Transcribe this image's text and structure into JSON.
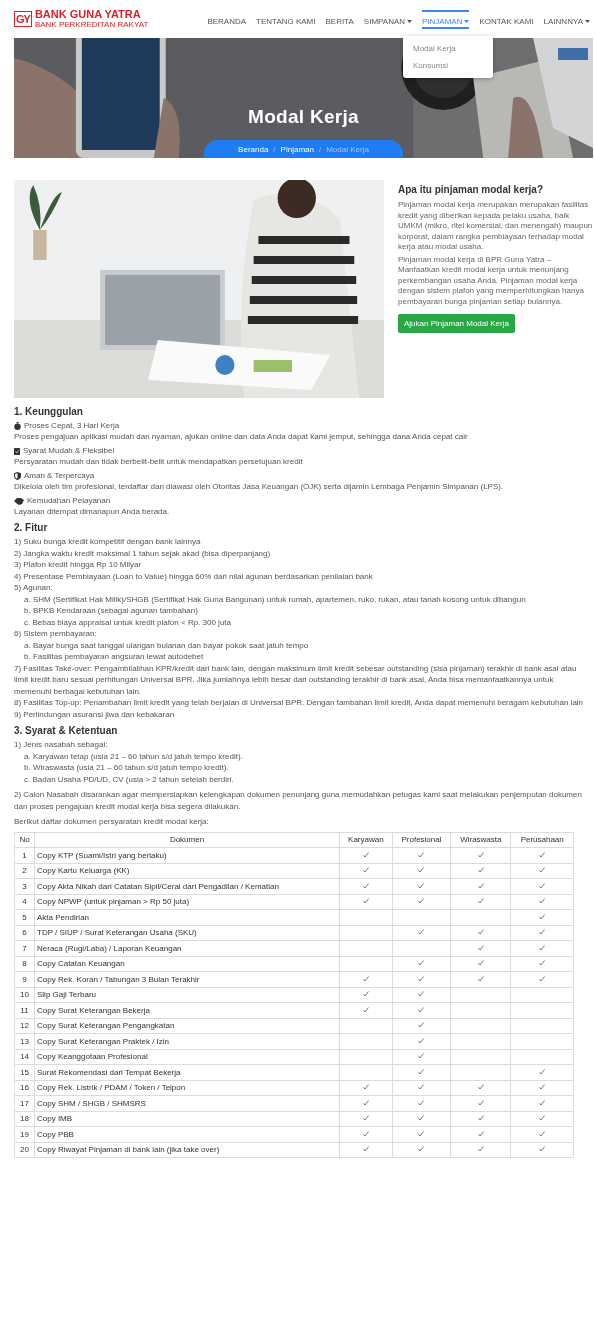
{
  "header": {
    "logo_mark": "GY",
    "brand": "BANK GUNA YATRA",
    "tagline": "BANK PERKREDITAN RAKYAT",
    "nav": [
      {
        "label": "BERANDA",
        "selected": false,
        "dropdown": false
      },
      {
        "label": "TENTANG KAMI",
        "selected": false,
        "dropdown": false
      },
      {
        "label": "BERITA",
        "selected": false,
        "dropdown": false
      },
      {
        "label": "SIMPANAN",
        "selected": false,
        "dropdown": true
      },
      {
        "label": "PINJAMAN",
        "selected": true,
        "dropdown": true,
        "menu": [
          "Modal Kerja",
          "Konsumsi"
        ]
      },
      {
        "label": "KONTAK KAMI",
        "selected": false,
        "dropdown": false
      },
      {
        "label": "LAINNNYA",
        "selected": false,
        "dropdown": true
      }
    ]
  },
  "hero": {
    "title": "Modal Kerja",
    "breadcrumb": [
      {
        "label": "Beranda",
        "current": false
      },
      {
        "label": "Pinjaman",
        "current": false
      },
      {
        "label": "Modal Kerja",
        "current": true
      }
    ],
    "separator": "/"
  },
  "intro": {
    "heading": "Apa itu pinjaman modal kerja?",
    "paragraphs": [
      "Pinjaman modal kerja merupakan merupakan fasilitas kredit yang diberikan kepada pelaku usaha, baik UMKM (mikro, ritel komersial, dan menengah) maupun korporat, dalam rangka pembiayaan terhadap modal kerja atau modal usaha.",
      "Pinjaman modal kerja di BPR Guna Yatra – Manfaatkan kredit modal kerja untuk menunjang perkembangan usaha Anda. Pinjaman modal kerja dengan sistem plafon yang memperhitungkan hanya pembayaran bunga pinjaman setiap bulannya."
    ],
    "button": "Ajukan Pinjaman Modal Kerja"
  },
  "advantages": {
    "heading": "1. Keunggulan",
    "items": [
      {
        "title": "Proses Cepat, 3 Hari Kerja",
        "text": "Proses pengajuan aplikasi mudah dan nyaman, ajukan online dan data Anda dapat kami jemput, sehingga dana Anda cepat cair"
      },
      {
        "title": "Syarat Mudah & Fleksibel",
        "text": "Persyaratan mudah dan tidak berbelit-belit untuk mendapatkan persetujuan kredit"
      },
      {
        "title": "Aman & Terpercaya",
        "text": "Dikelola oleh tim profesional, terdaftar dan diawasi oleh Otoritas Jasa Keuangan (OJK) serta dijamin Lembaga Penjamin Simpanan (LPS)."
      },
      {
        "title": "Kemudahan Pelayanan",
        "text": "Layanan ditempat dimanapun Anda berada."
      }
    ]
  },
  "features": {
    "heading": "2. Fitur",
    "items": [
      {
        "text": "1) Suku bunga kredit kompetitif dengan bank lainnya"
      },
      {
        "text": "2) Jangka waktu kredit maksimal 1 tahun sejak akad (bisa diperpanjang)"
      },
      {
        "text": "3) Plafon kredit hingga Rp 10 Milyar"
      },
      {
        "text": "4) Presentase Pembiayaan (Loan to Value) hingga 60% dari nilai agunan berdasarkan penilaian bank"
      },
      {
        "text": "5) Agunan:",
        "children": [
          "a. SHM (Sertifikat Hak Milik)/SHGB (Sertifikat Hak Guna Bangunan) untuk rumah, apartemen, ruko, rukan, atau tanah kosong untuk dibangun",
          "b. BPKB Kendaraan (sebagai agunan tambahan)",
          "c. Bebas biaya appraisal untuk kredit plafon < Rp. 300 juta"
        ]
      },
      {
        "text": "6) Sistem pembayaran:",
        "children": [
          "a. Bayar bunga saat tanggal ulangan bulanan dan bayar pokok saat jatuh tempo",
          "b. Fasilitas pembayaran angsuran lewat autodebet"
        ]
      },
      {
        "text": "7) Fasilitas Take-over: Pengambilalihan KPR/kredit dari bank lain, dengan maksimum limit kredit sebesar outstanding (sisa pinjaman) terakhir di bank asal atau limit kredit baru sesuai perhitungan Universal BPR. Jika jumlahnya lebih besar dari outstanding terakhir di bank asal, Anda bisa memanfaatkannya untuk memenuhi berbagai kebutuhan lain."
      },
      {
        "text": "8) Fasilitas Top-up: Penambahan limit kredit yang telah berjalan di Universal BPR. Dengan tambahan limit kredit, Anda dapat memenuhi beragam kebutuhan lain"
      },
      {
        "text": "9) Perlindungan asuransi jiwa dan kebakaran"
      }
    ]
  },
  "terms": {
    "heading": "3. Syarat & Ketentuan",
    "items": [
      {
        "text": "1) Jenis nasabah sebagai:",
        "children": [
          "a. Karyawan tetap (usia 21 – 60 tahun s/d jatuh tempo kredit).",
          "b. Wiraswasta (usia 21 – 60 tahun s/d jatuh tempo kredit).",
          "c. Badan Usaha PD/UD, CV (usia > 2 tahun setelah berdiri."
        ]
      },
      {
        "text": "2) Calon Nasabah disarankan agar mempersiapkan kelengkapan dokumen penunjang guna memudahkan petugas kami saat melakukan penjemputan dokumen dan proses pengajuan kredit modal kerja bisa segera dilakukan."
      },
      {
        "text": "Berikut daftar dokumen persyaratan kredit modal kerja:"
      }
    ],
    "table": {
      "columns": [
        "No",
        "Dokumen",
        "Karyawan",
        "Profesional",
        "Wiraswasta",
        "Perusahaan"
      ],
      "rows": [
        {
          "no": "1",
          "document": "Copy KTP (Suami/Istri yang berlaku)",
          "checks": [
            true,
            true,
            true,
            true
          ]
        },
        {
          "no": "2",
          "document": "Copy Kartu Keluarga (KK)",
          "checks": [
            true,
            true,
            true,
            true
          ]
        },
        {
          "no": "3",
          "document": "Copy Akta Nikah dari Catatan Sipil/Cerai dari Pengadilan / Kematian",
          "checks": [
            true,
            true,
            true,
            true
          ]
        },
        {
          "no": "4",
          "document": "Copy NPWP (untuk pinjaman > Rp 50 juta)",
          "checks": [
            true,
            true,
            true,
            true
          ]
        },
        {
          "no": "5",
          "document": "Akta Pendirian",
          "checks": [
            false,
            false,
            false,
            true
          ]
        },
        {
          "no": "6",
          "document": "TDP / SIUP / Surat Keterangan Usaha (SKU)",
          "checks": [
            false,
            true,
            true,
            true
          ]
        },
        {
          "no": "7",
          "document": "Neraca (Rugi/Laba) / Laporan Keuangan",
          "checks": [
            false,
            false,
            true,
            true
          ]
        },
        {
          "no": "8",
          "document": "Copy Catatan Keuangan",
          "checks": [
            false,
            true,
            true,
            true
          ]
        },
        {
          "no": "9",
          "document": "Copy Rek. Koran / Tabungan 3 Bulan Terakhir",
          "checks": [
            true,
            true,
            true,
            true
          ]
        },
        {
          "no": "10",
          "document": "Slip Gaji Terbaru",
          "checks": [
            true,
            true,
            false,
            false
          ]
        },
        {
          "no": "11",
          "document": "Copy Surat Keterangan Bekerja",
          "checks": [
            true,
            true,
            false,
            false
          ]
        },
        {
          "no": "12",
          "document": "Copy Surat Keterangan Pengangkatan",
          "checks": [
            false,
            true,
            false,
            false
          ]
        },
        {
          "no": "13",
          "document": "Copy Surat Keterangan Praktek / Izin",
          "checks": [
            false,
            true,
            false,
            false
          ]
        },
        {
          "no": "14",
          "document": "Copy Keanggotaan Profesional",
          "checks": [
            false,
            true,
            false,
            false
          ]
        },
        {
          "no": "15",
          "document": "Surat Rekomendasi dari Tempat Bekerja",
          "checks": [
            false,
            true,
            false,
            true
          ]
        },
        {
          "no": "16",
          "document": "Copy Rek. Listrik / PDAM / Token / Telpon",
          "checks": [
            true,
            true,
            true,
            true
          ]
        },
        {
          "no": "17",
          "document": "Copy SHM / SHGB / SHMSRS",
          "checks": [
            true,
            true,
            true,
            true
          ]
        },
        {
          "no": "18",
          "document": "Copy IMB",
          "checks": [
            true,
            true,
            true,
            true
          ]
        },
        {
          "no": "19",
          "document": "Copy PBB",
          "checks": [
            true,
            true,
            true,
            true
          ]
        },
        {
          "no": "20",
          "document": "Copy Riwayat Pinjaman di bank lain (jika take over)",
          "checks": [
            true,
            true,
            true,
            true
          ]
        }
      ]
    }
  }
}
